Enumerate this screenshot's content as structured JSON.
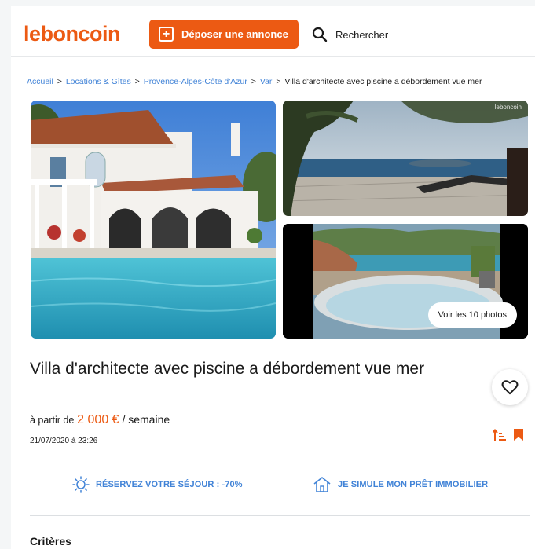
{
  "header": {
    "logo": "leboncoin",
    "deposit_label": "Déposer une annonce",
    "search_label": "Rechercher"
  },
  "breadcrumb": {
    "items": [
      "Accueil",
      "Locations & Gîtes",
      "Provence-Alpes-Côte d'Azur",
      "Var"
    ],
    "current": "Villa d'architecte avec piscine a débordement vue mer",
    "separator": ">"
  },
  "gallery": {
    "watermark": "leboncoin",
    "photos_button": "Voir les 10 photos"
  },
  "listing": {
    "title": "Villa d'architecte avec piscine a débordement vue mer",
    "price_prefix": "à partir de",
    "price": "2 000 €",
    "price_suffix": "/ semaine",
    "date": "21/07/2020 à 23:26"
  },
  "services": {
    "booking": "RÉSERVEZ VOTRE SÉJOUR : -70%",
    "loan": "JE SIMULE MON PRÊT IMMOBILIER"
  },
  "criteria": {
    "heading": "Critères"
  },
  "colors": {
    "brand": "#ec5a13",
    "link": "#4183d7",
    "text": "#1a1a1a"
  },
  "icons": [
    "plus-icon",
    "search-icon",
    "heart-icon",
    "sort-icon",
    "bookmark-icon",
    "sun-icon",
    "house-icon"
  ]
}
